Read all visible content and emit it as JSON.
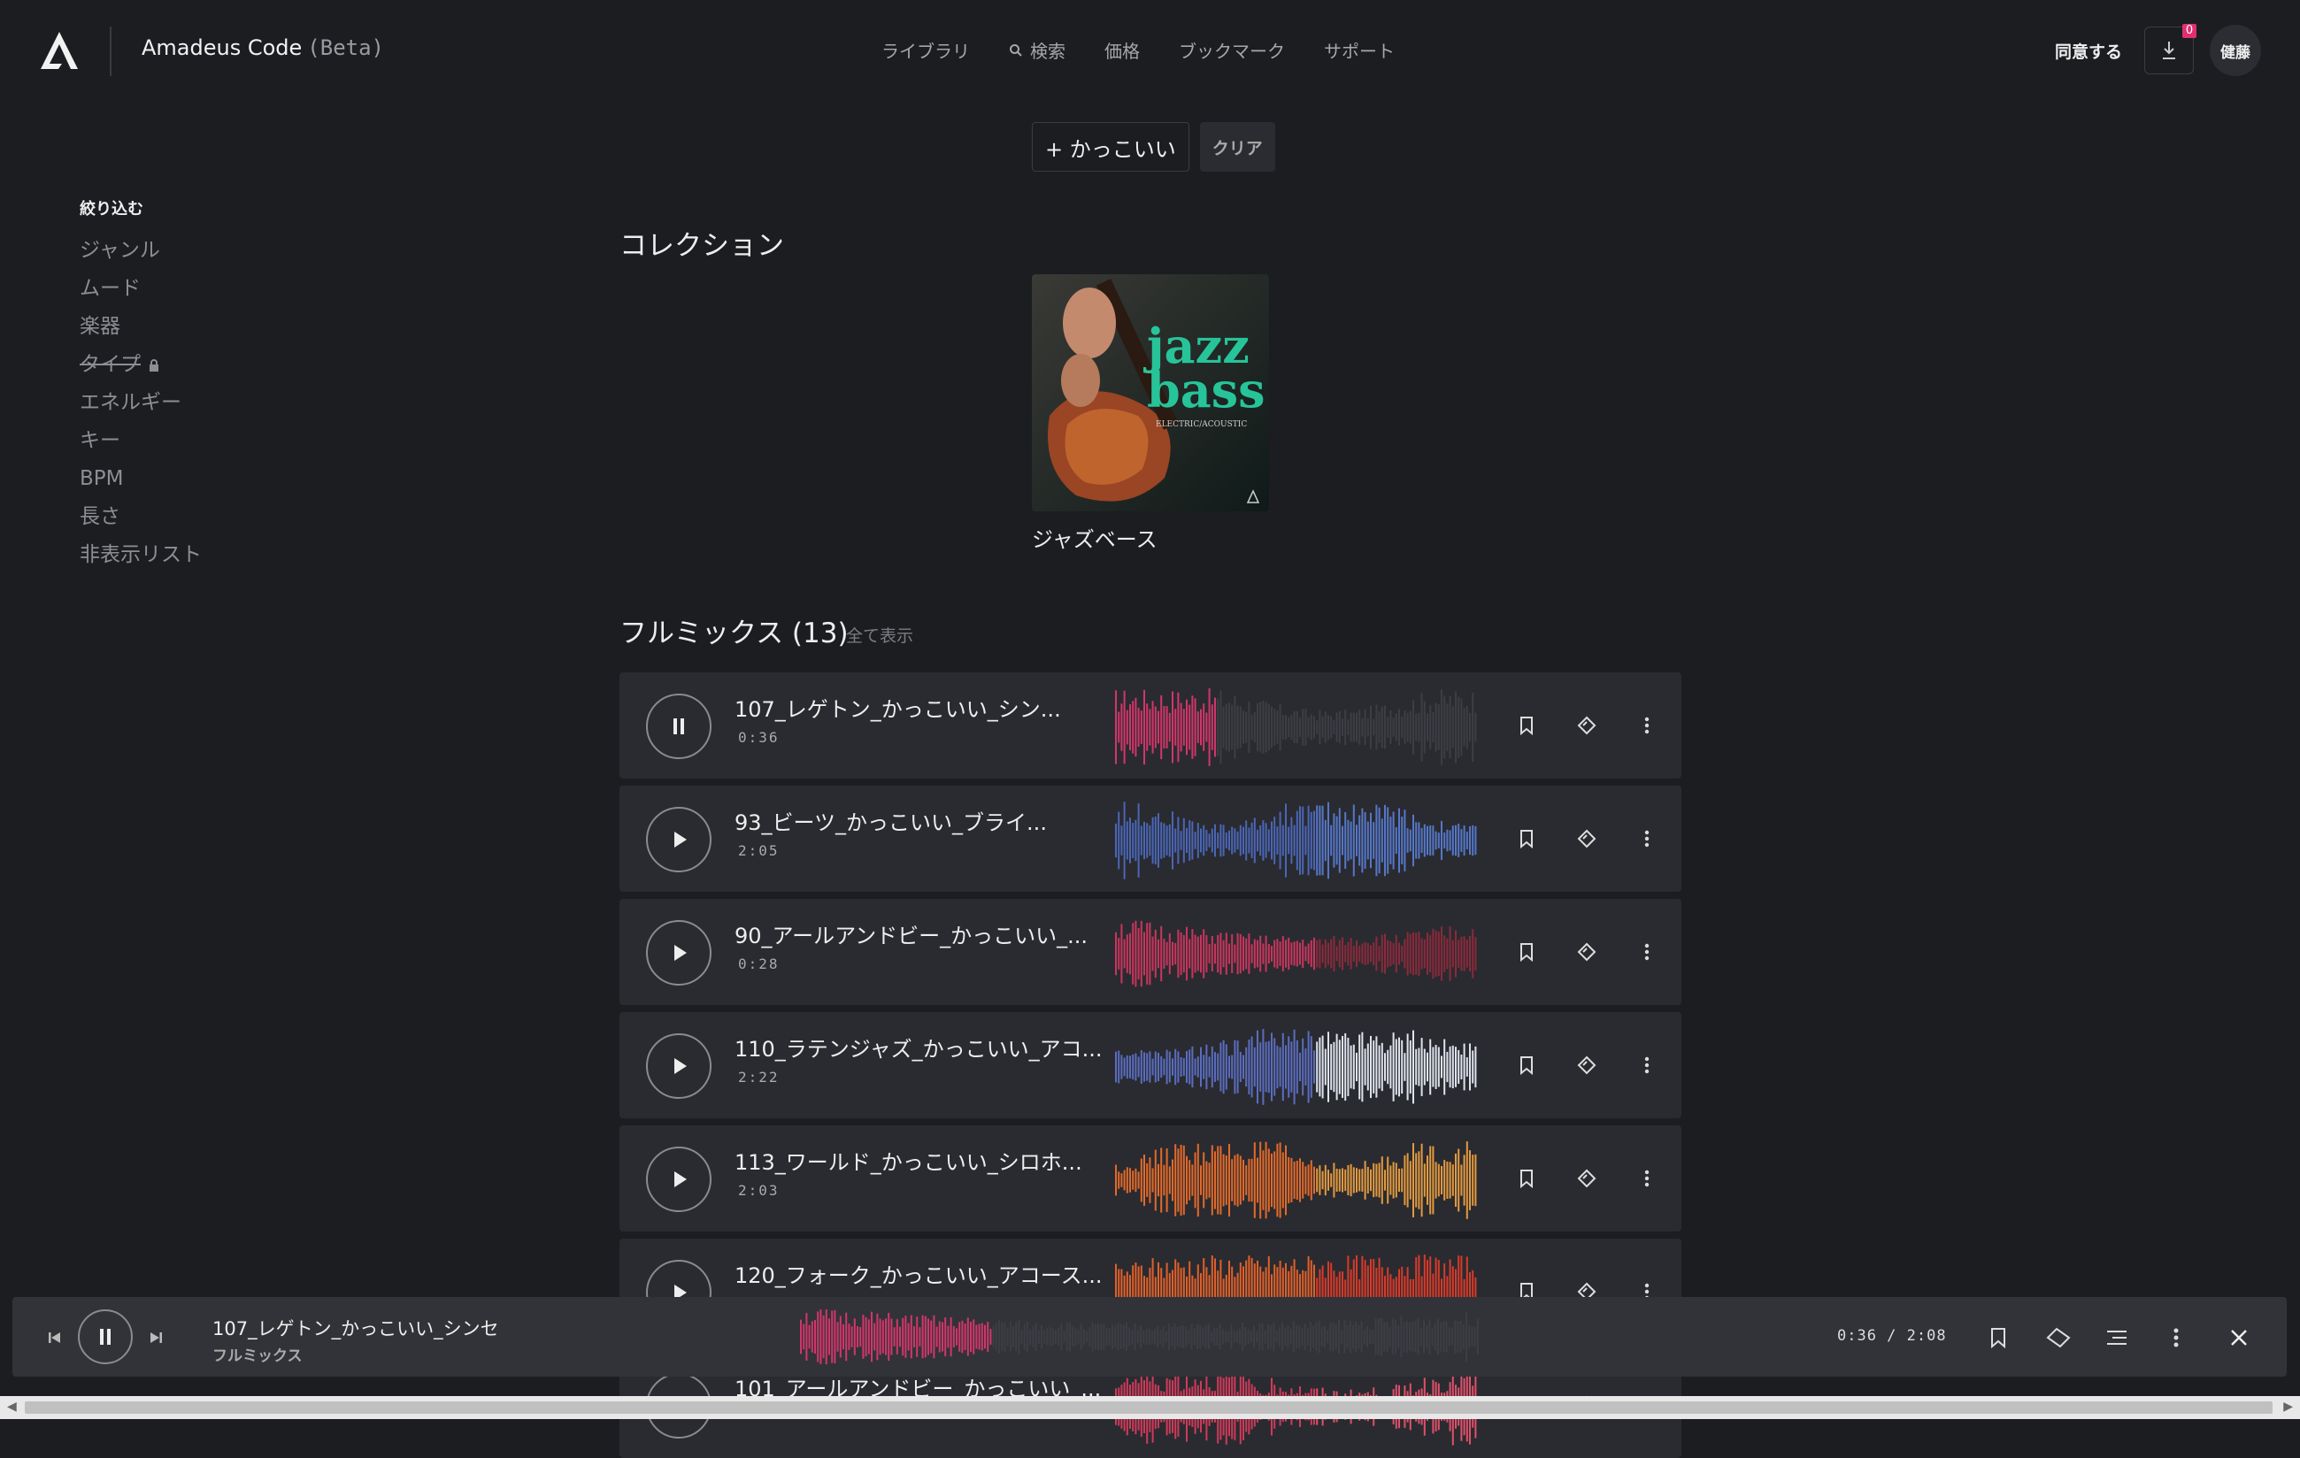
{
  "header": {
    "brand": "Amadeus Code",
    "beta": "(Beta)",
    "nav": [
      "ライブラリ",
      "検索",
      "価格",
      "ブックマーク",
      "サポート"
    ],
    "agree": "同意する",
    "download_count": "0",
    "user": "健藤"
  },
  "chips": {
    "tag": "+ かっこいい",
    "clear": "クリア"
  },
  "filter": {
    "title": "絞り込む",
    "items": [
      "ジャンル",
      "ムード",
      "楽器",
      "タイプ",
      "エネルギー",
      "キー",
      "BPM",
      "長さ",
      "非表示リスト"
    ]
  },
  "collection": {
    "title": "コレクション",
    "item_label": "ジャズベース",
    "cover_text1": "jazz",
    "cover_text2": "bass",
    "cover_sub": "ELECTRIC/ACOUSTIC"
  },
  "fullmix": {
    "title": "フルミックス (13)",
    "show_all": "全て表示",
    "tracks": [
      {
        "name": "107_レゲトン_かっこいい_シン...",
        "dur": "0:36",
        "state": "pause",
        "color": "#d2366a",
        "color2": "#3a3b40",
        "progress": 0.28
      },
      {
        "name": "93_ビーツ_かっこいい_ブライ...",
        "dur": "2:05",
        "state": "play",
        "color": "#4a66b6",
        "color2": "#5577c9",
        "progress": 1
      },
      {
        "name": "90_アールアンドビー_かっこいい_...",
        "dur": "0:28",
        "state": "play",
        "color": "#c8365e",
        "color2": "#8a2a3c",
        "progress": 1
      },
      {
        "name": "110_ラテンジャズ_かっこいい_アコ...",
        "dur": "2:22",
        "state": "play",
        "color": "#5a6dbf",
        "color2": "#dfe3ee",
        "progress": 1
      },
      {
        "name": "113_ワールド_かっこいい_シロホ...",
        "dur": "2:03",
        "state": "play",
        "color": "#e36a2a",
        "color2": "#e39a40",
        "progress": 1
      },
      {
        "name": "120_フォーク_かっこいい_アコース...",
        "dur": "",
        "state": "play",
        "color": "#e0602a",
        "color2": "#d83a2a",
        "progress": 1
      },
      {
        "name": "101_アールアンドビー_かっこいい_...",
        "dur": "",
        "state": "play",
        "color": "#d03a5a",
        "color2": "#e0506a",
        "progress": 1
      }
    ]
  },
  "player": {
    "title": "107_レゲトン_かっこいい_シンセ",
    "sub": "フルミックス",
    "time": "0:36 / 2:08",
    "color": "#d2366a",
    "progress": 0.28
  }
}
